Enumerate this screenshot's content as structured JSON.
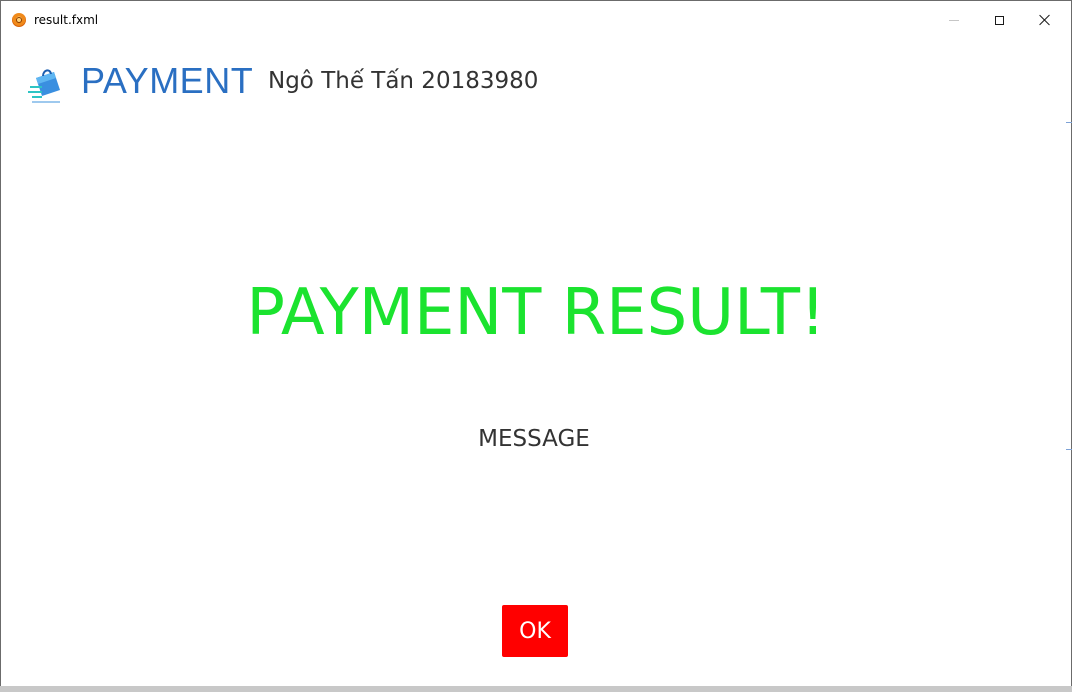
{
  "window": {
    "title": "result.fxml"
  },
  "header": {
    "brand": "PAYMENT",
    "student": "Ngô Thế Tấn 20183980"
  },
  "main": {
    "result_title": "PAYMENT RESULT!",
    "message": "MESSAGE",
    "ok_label": "OK"
  },
  "colors": {
    "brand": "#2a6fc2",
    "result_title": "#1be32f",
    "ok_button": "#ff0000"
  },
  "icons": {
    "app": "app-icon",
    "logo": "shopping-bag-logo",
    "minimize": "minimize-icon",
    "maximize": "maximize-icon",
    "close": "close-icon"
  }
}
